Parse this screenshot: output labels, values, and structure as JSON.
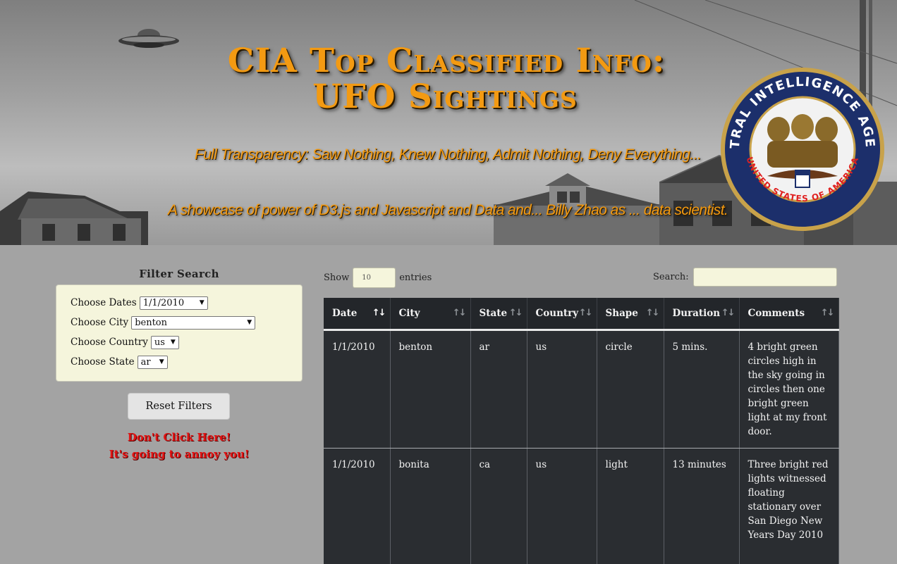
{
  "banner": {
    "title_line1": "CIA Top Classified Info:",
    "title_line2": "UFO Sightings",
    "subtitle1": "Full Transparency:  Saw Nothing, Knew Nothing, Admit Nothing, Deny Everything...",
    "subtitle2": "A showcase of power of D3.js and Javascript and Data and... Billy Zhao as ... data scientist.",
    "seal_text_top": "CENTRAL INTELLIGENCE AGENCY",
    "seal_text_bottom": "UNITED STATES OF AMERICA"
  },
  "filters": {
    "heading": "Filter Search",
    "date": {
      "label": "Choose Dates",
      "value": "1/1/2010"
    },
    "city": {
      "label": "Choose City",
      "value": "benton"
    },
    "country": {
      "label": "Choose Country",
      "value": "us"
    },
    "state": {
      "label": "Choose State",
      "value": "ar"
    },
    "reset_label": "Reset Filters",
    "warning_line1": "Don't Click Here!",
    "warning_line2": "It's going to annoy you!"
  },
  "table_controls": {
    "show_label": "Show",
    "page_length": "10",
    "entries_label": "entries",
    "search_label": "Search:",
    "search_value": ""
  },
  "table": {
    "columns": [
      "Date",
      "City",
      "State",
      "Country",
      "Shape",
      "Duration",
      "Comments"
    ],
    "sorted_column": "Date",
    "rows": [
      {
        "date": "1/1/2010",
        "city": "benton",
        "state": "ar",
        "country": "us",
        "shape": "circle",
        "duration": "5 mins.",
        "comments": "4 bright green circles high in the sky going in circles then one bright green light at my front door."
      },
      {
        "date": "1/1/2010",
        "city": "bonita",
        "state": "ca",
        "country": "us",
        "shape": "light",
        "duration": "13 minutes",
        "comments": "Three bright red lights witnessed floating stationary over San Diego New Years Day 2010"
      }
    ]
  },
  "colors": {
    "banner_text": "#f39a12",
    "page_bg": "#a3a3a3",
    "panel_bg": "#f5f5dc",
    "table_bg": "#2a2d31",
    "warning": "#e11414"
  },
  "icons": [
    "ufo-icon",
    "cia-seal-icon",
    "sort-icon",
    "caret-down-icon"
  ]
}
